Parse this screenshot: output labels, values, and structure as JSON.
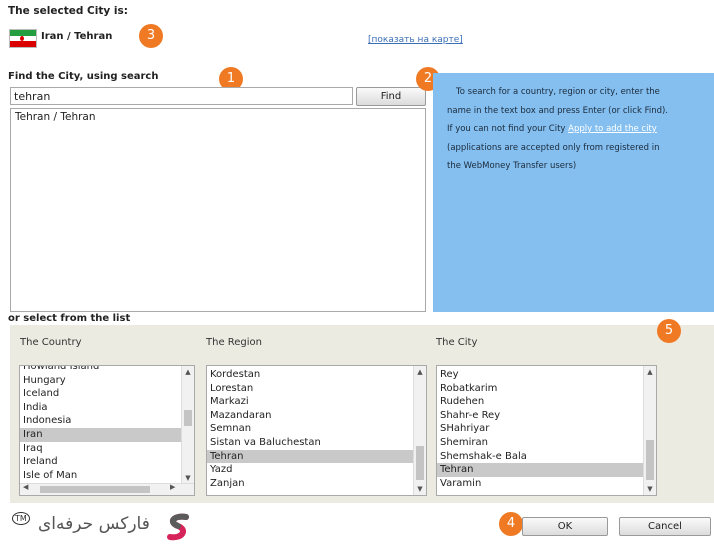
{
  "selected": {
    "heading": "The selected City is:",
    "city": "Iran / Tehran",
    "map_link": "[показать на карте]"
  },
  "search": {
    "heading": "Find the City, using search",
    "value": "tehran",
    "find_label": "Find",
    "results": [
      "Tehran / Tehran"
    ]
  },
  "info": {
    "line1": "To search for a country, region or city, enter the",
    "line2": "name in the text box and press Enter (or click Find).",
    "line3_pre": "If you can not find your City ",
    "line3_link": "Apply to add the city",
    "line4": "(applications are accepted only from registered in",
    "line5": "the WebMoney Transfer users)"
  },
  "list_section": {
    "heading": "or select from the list",
    "country_label": "The Country",
    "region_label": "The Region",
    "city_label": "The City",
    "countries": [
      "Howland Island",
      "Hungary",
      "Iceland",
      "India",
      "Indonesia",
      "Iran",
      "Iraq",
      "Ireland",
      "Isle of Man"
    ],
    "countries_selected": "Iran",
    "regions": [
      "Kordestan",
      "Lorestan",
      "Markazi",
      "Mazandaran",
      "Semnan",
      "Sistan va Baluchestan",
      "Tehran",
      "Yazd",
      "Zanjan"
    ],
    "regions_selected": "Tehran",
    "cities": [
      "Rey",
      "Robatkarim",
      "Rudehen",
      "Shahr-e Rey",
      "SHahriyar",
      "Shemiran",
      "Shemshak-e Bala",
      "Tehran",
      "Varamin"
    ],
    "cities_selected": "Tehran"
  },
  "buttons": {
    "ok": "OK",
    "cancel": "Cancel"
  },
  "badges": {
    "b1": "1",
    "b2": "2",
    "b3": "3",
    "b4": "4",
    "b5": "5"
  },
  "logo": {
    "text": "فارکس حرفه‌ای",
    "tm": "TM"
  },
  "colors": {
    "badge": "#f07a24",
    "info_panel": "#84bff0",
    "list_area": "#ecebe2"
  }
}
